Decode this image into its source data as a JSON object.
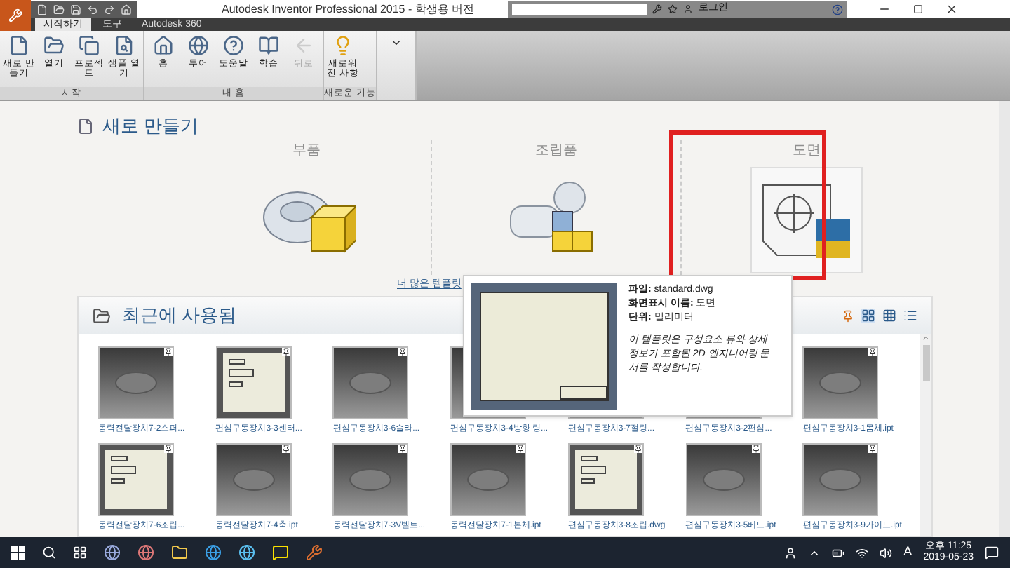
{
  "window": {
    "title": "Autodesk Inventor Professional 2015 - 학생용 버전",
    "login": "로그인"
  },
  "tabs": [
    {
      "label": "시작하기",
      "selected": true
    },
    {
      "label": "도구",
      "selected": false
    },
    {
      "label": "Autodesk 360",
      "selected": false
    }
  ],
  "ribbon": [
    {
      "title": "시작",
      "buttons": [
        {
          "label": "새로 만들기",
          "disabled": false
        },
        {
          "label": "열기",
          "disabled": false
        },
        {
          "label": "프로젝트",
          "disabled": false
        },
        {
          "label": "샘플 열기",
          "disabled": false
        }
      ]
    },
    {
      "title": "내 홈",
      "buttons": [
        {
          "label": "홈",
          "disabled": false
        },
        {
          "label": "투어",
          "disabled": false
        },
        {
          "label": "도움말",
          "disabled": false
        },
        {
          "label": "학습",
          "disabled": false
        },
        {
          "label": "뒤로",
          "disabled": true
        }
      ]
    },
    {
      "title": "새로운 기능",
      "buttons": [
        {
          "label": "새로워진 사항",
          "disabled": false
        }
      ]
    }
  ],
  "new_section": {
    "title": "새로 만들기",
    "templates": [
      {
        "label": "부품",
        "kind": "part"
      },
      {
        "label": "조립품",
        "kind": "assembly"
      },
      {
        "label": "도면",
        "kind": "drawing"
      }
    ],
    "more_link": "더 많은 템플릿"
  },
  "tooltip": {
    "lines": [
      "**파일:** standard.dwg",
      "**화면표시 이름:** 도면",
      "**단위:** 밀리미터"
    ],
    "description": "이 템플릿은 구성요소 뷰와 상세 정보가 포함된 2D 엔지니어링 문서를 작성합니다."
  },
  "recent": {
    "title": "최근에 사용됨",
    "files": [
      {
        "name": "동력전달장치7-2스퍼...",
        "kind": "part"
      },
      {
        "name": "편심구동장치3-3센터...",
        "kind": "drawing"
      },
      {
        "name": "편심구동장치3-6슬라...",
        "kind": "part"
      },
      {
        "name": "편심구동장치3-4방향 링...",
        "kind": "part"
      },
      {
        "name": "편심구동장치3-7절링...",
        "kind": "part"
      },
      {
        "name": "편심구동장치3-2편심...",
        "kind": "part"
      },
      {
        "name": "편심구동장치3-1몸체.ipt",
        "kind": "part"
      },
      {
        "name": "동력전달장치7-6조립...",
        "kind": "drawing"
      },
      {
        "name": "동력전달장치7-4축.ipt",
        "kind": "part"
      },
      {
        "name": "동력전달장치7-3V벨트...",
        "kind": "part"
      },
      {
        "name": "동력전달장치7-1본체.ipt",
        "kind": "part"
      },
      {
        "name": "편심구동장치3-8조립.dwg",
        "kind": "drawing"
      },
      {
        "name": "편심구동장치3-5베드.ipt",
        "kind": "part"
      },
      {
        "name": "편심구동장치3-9가이드.ipt",
        "kind": "part"
      }
    ]
  },
  "taskbar": {
    "time": "오후 11:25",
    "date": "2019-05-23",
    "ime": "A"
  }
}
